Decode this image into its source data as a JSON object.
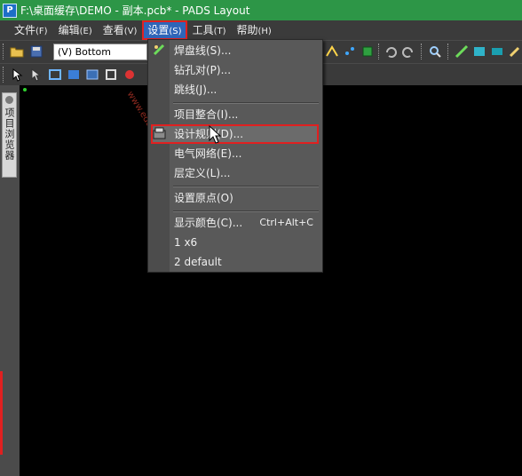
{
  "window": {
    "title": "F:\\桌面缓存\\DEMO - 副本.pcb* - PADS Layout",
    "logo_glyph": "P"
  },
  "menubar": [
    {
      "label": "文件",
      "accel": "(F)"
    },
    {
      "label": "编辑",
      "accel": "(E)"
    },
    {
      "label": "查看",
      "accel": "(V)"
    },
    {
      "label": "设置",
      "accel": "(S)"
    },
    {
      "label": "工具",
      "accel": "(T)"
    },
    {
      "label": "帮助",
      "accel": "(H)"
    }
  ],
  "toolbar": {
    "layer_select_value": "(V) Bottom"
  },
  "left_panel": {
    "tab_label": "项目浏览器"
  },
  "canvas": {
    "watermark": "www.eda1024.com"
  },
  "settings_menu": {
    "items": [
      {
        "label": "焊盘线(S)...",
        "icon": "pad-wire-icon"
      },
      {
        "label": "钻孔对(P)..."
      },
      {
        "label": "跳线(J)..."
      },
      {
        "label": "项目整合(I)..."
      },
      {
        "label": "设计规则(D)...",
        "icon": "design-rules-icon",
        "highlighted": true
      },
      {
        "label": "电气网络(E)..."
      },
      {
        "label": "层定义(L)..."
      },
      {
        "label": "设置原点(O)"
      },
      {
        "label": "显示颜色(C)...",
        "shortcut": "Ctrl+Alt+C"
      },
      {
        "label": "1 x6"
      },
      {
        "label": "2 default"
      }
    ]
  },
  "colors": {
    "titlebar": "#2d9647",
    "menu_active": "#2f65b8",
    "highlight_box": "#e02020",
    "canvas": "#000000"
  }
}
